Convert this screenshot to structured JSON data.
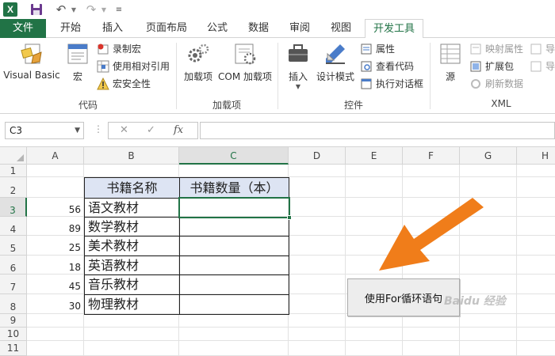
{
  "titlebar": {
    "logo": "X",
    "colors": {
      "brand": "#217346"
    }
  },
  "tabs": [
    {
      "label": "文件",
      "active": false
    },
    {
      "label": "开始",
      "active": false
    },
    {
      "label": "插入",
      "active": false
    },
    {
      "label": "页面布局",
      "active": false
    },
    {
      "label": "公式",
      "active": false
    },
    {
      "label": "数据",
      "active": false
    },
    {
      "label": "审阅",
      "active": false
    },
    {
      "label": "视图",
      "active": false
    },
    {
      "label": "开发工具",
      "active": true
    }
  ],
  "ribbon": {
    "code": {
      "label": "代码",
      "visual_basic": "Visual Basic",
      "macros": "宏",
      "record_macro": "录制宏",
      "relative_ref": "使用相对引用",
      "macro_security": "宏安全性"
    },
    "addins": {
      "label": "加载项",
      "addins": "加载项",
      "com": "COM 加载项"
    },
    "controls": {
      "label": "控件",
      "insert": "插入",
      "design_mode": "设计模式",
      "properties": "属性",
      "view_code": "查看代码",
      "run_dialog": "执行对话框"
    },
    "xml": {
      "label": "XML",
      "source": "源",
      "map_props": "映射属性",
      "expansion": "扩展包",
      "refresh": "刷新数据",
      "import": "导",
      "export": "导"
    }
  },
  "formula_bar": {
    "name_box": "C3",
    "fx": "fx",
    "value": ""
  },
  "grid": {
    "columns": [
      "A",
      "B",
      "C",
      "D",
      "E",
      "F",
      "G",
      "H"
    ],
    "rows": [
      "1",
      "2",
      "3",
      "4",
      "5",
      "6",
      "7",
      "8",
      "9",
      "10",
      "11"
    ],
    "selected_cell": "C3",
    "headers": [
      "书籍名称",
      "书籍数量（本）"
    ],
    "data": [
      {
        "a": "56",
        "b": "语文教材",
        "c": ""
      },
      {
        "a": "89",
        "b": "数学教材",
        "c": ""
      },
      {
        "a": "25",
        "b": "美术教材",
        "c": ""
      },
      {
        "a": "18",
        "b": "英语教材",
        "c": ""
      },
      {
        "a": "45",
        "b": "音乐教材",
        "c": ""
      },
      {
        "a": "30",
        "b": "物理教材",
        "c": ""
      }
    ]
  },
  "macro_button": {
    "label": "使用For循环语句"
  },
  "annotation": {
    "icon": "arrow-icon",
    "color": "#f07d1a"
  },
  "watermark": "Baidu 经验"
}
